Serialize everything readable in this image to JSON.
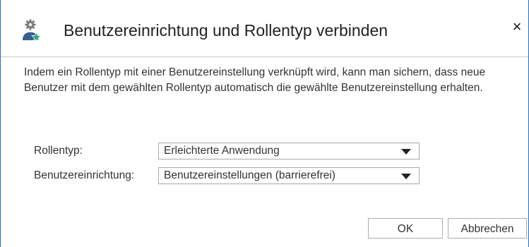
{
  "dialog": {
    "title": "Benutzereinrichtung und Rollentyp verbinden",
    "icon": "user-gear-star-icon",
    "close_label": "×",
    "description": "Indem ein Rollentyp mit einer Benutzereinstellung verknüpft wird, kann man sichern, dass neue Benutzer mit dem gewählten Rollentyp automatisch die gewählte Benutzereinstellung erhalten."
  },
  "form": {
    "rollentyp": {
      "label": "Rollentyp:",
      "value": "Erleichterte Anwendung"
    },
    "benutzereinrichtung": {
      "label": "Benutzereinrichtung:",
      "value": "Benutzereinstellungen (barrierefrei)"
    }
  },
  "buttons": {
    "ok": "OK",
    "cancel": "Abbrechen"
  },
  "colors": {
    "window_border": "#2a6fb0",
    "icon_gray": "#7a7a7a",
    "icon_blue": "#3b5f8a",
    "icon_star": "#2fa38a"
  }
}
